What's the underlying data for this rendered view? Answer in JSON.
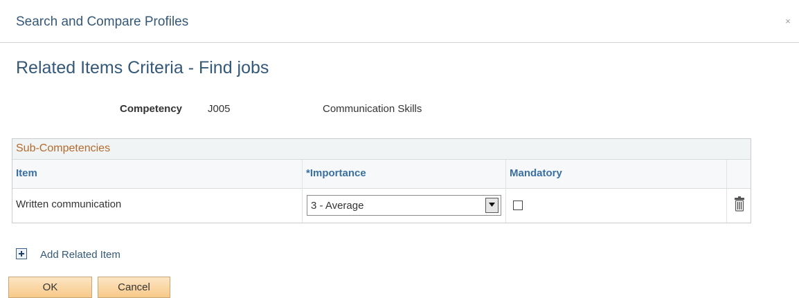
{
  "window": {
    "title": "Search and Compare Profiles",
    "close_label": "×"
  },
  "page": {
    "title": "Related Items Criteria - Find jobs"
  },
  "competency": {
    "label": "Competency",
    "code": "J005",
    "description": "Communication Skills"
  },
  "grid": {
    "title": "Sub-Competencies",
    "columns": {
      "item": "Item",
      "importance": "*Importance",
      "mandatory": "Mandatory"
    },
    "rows": [
      {
        "item": "Written communication",
        "importance": "3 - Average",
        "mandatory": false
      }
    ]
  },
  "actions": {
    "add_related_item": "Add Related Item",
    "ok": "OK",
    "cancel": "Cancel"
  }
}
